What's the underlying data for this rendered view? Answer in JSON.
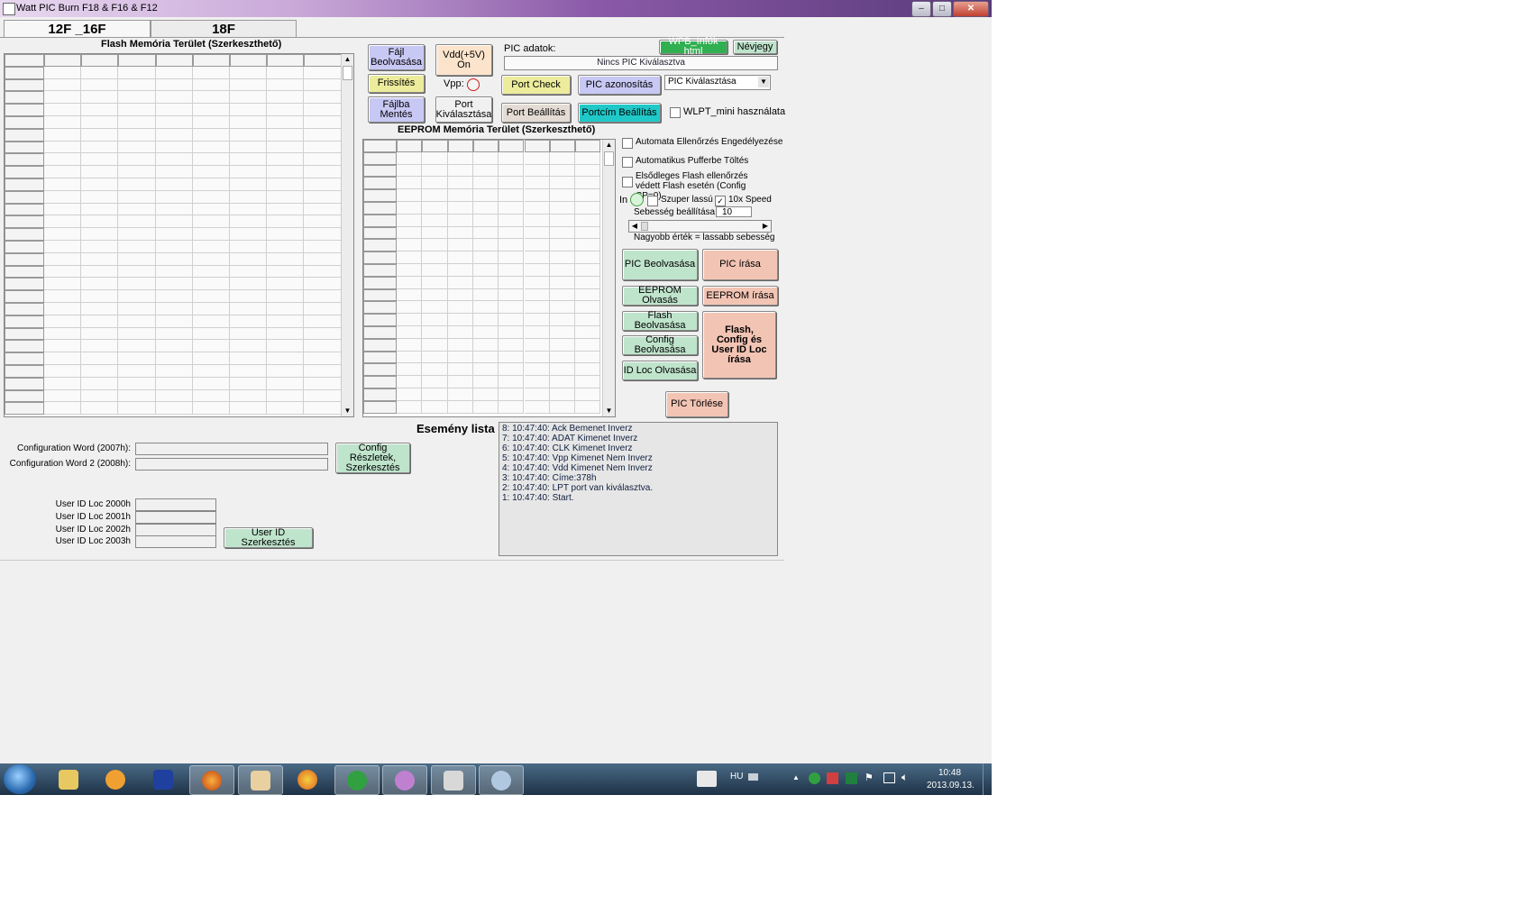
{
  "window": {
    "title": "Watt PIC Burn F18 & F16 & F12",
    "controls": [
      "–",
      "□",
      "✕"
    ]
  },
  "tabs": [
    {
      "label": "12F _16F"
    },
    {
      "label": "18F"
    }
  ],
  "flash": {
    "title": "Flash Memória Terület (Szerkeszthető)"
  },
  "eeprom": {
    "title": "EEPROM Memória Terület (Szerkeszthető)"
  },
  "buttons": {
    "file_read": "Fájl Beolvasása",
    "vdd_on": "Vdd(+5V) On",
    "refresh": "Frissítés",
    "vpp_label": "Vpp:",
    "save_file": "Fájlba Mentés",
    "port_select": "Port Kiválasztása",
    "port_check": "Port Check",
    "pic_identify": "PIC azonosítás",
    "port_settings": "Port Beállítás",
    "portcim_settings": "Portcím Beállítás",
    "wpb_info": "WPB_Infók html",
    "about": "Névjegy",
    "pic_read": "PIC Beolvasása",
    "pic_write": "PIC   írása",
    "eeprom_read": "EEPROM Olvasás",
    "eeprom_write": "EEPROM írása",
    "flash_read": "Flash Beolvasása",
    "config_read": "Config Beolvasása",
    "idloc_read": "ID Loc Olvasása",
    "flash_config_write": "Flash, Config és User ID Loc írása",
    "pic_erase": "PIC  Törlése",
    "config_edit": "Config Részletek, Szerkesztés",
    "userid_edit": "User ID Szerkesztés"
  },
  "pic": {
    "label": "PIC adatok:",
    "status": "Nincs PIC Kiválasztva",
    "select": "PIC Kiválasztása"
  },
  "options": {
    "wlpt_mini": "WLPT_mini használata",
    "auto_verify": "Automata Ellenőrzés Engedélyezése",
    "auto_buffer": "Automatikus Pufferbe Töltés",
    "primary_flash": "Elsődleges Flash ellenőrzés védett Flash esetén (Config CP=0)",
    "in_label": "In",
    "super_slow": "Szuper lassú",
    "speed_10x": "10x Speed",
    "speed_label": "Sebesség beállítása :",
    "speed_value": "10",
    "speed_note": "Nagyobb érték = lassabb sebesség"
  },
  "config": {
    "word1_label": "Configuration Word (2007h):",
    "word2_label": "Configuration Word 2 (2008h):"
  },
  "userid": {
    "labels": [
      "User ID Loc 2000h",
      "User ID Loc 2001h",
      "User ID Loc 2002h",
      "User ID Loc 2003h"
    ]
  },
  "log": {
    "title": "Esemény lista",
    "entries": [
      "8:  10:47:40:  Ack Bemenet Inverz",
      "7:  10:47:40:  ADAT Kimenet Inverz",
      "6:  10:47:40:  CLK Kimenet Inverz",
      "5:  10:47:40:  Vpp Kimenet Nem Inverz",
      "4:  10:47:40:  Vdd Kimenet Nem Inverz",
      "3:  10:47:40:  Címe:378h",
      "2:  10:47:40:  LPT port van kiválasztva.",
      "1:  10:47:40:  Start."
    ]
  },
  "taskbar": {
    "lang": "HU",
    "time": "10:48",
    "date": "2013.09.13.",
    "apps": [
      "explorer-icon",
      "media-player-icon",
      "floppy-save-icon",
      "firefox-icon",
      "burner-tool-icon",
      "chrome-icon",
      "utorrent-icon",
      "paint-icon",
      "window-app-icon",
      "paint-palette-icon"
    ]
  },
  "colors": {
    "green_btn": "#bfe4cc",
    "red_btn": "#f2c4b4",
    "purple_btn": "#c8c8f4",
    "yellow_btn": "#ecec9c",
    "cyan_btn": "#20c8c8",
    "orange_btn": "#fce4cc"
  }
}
